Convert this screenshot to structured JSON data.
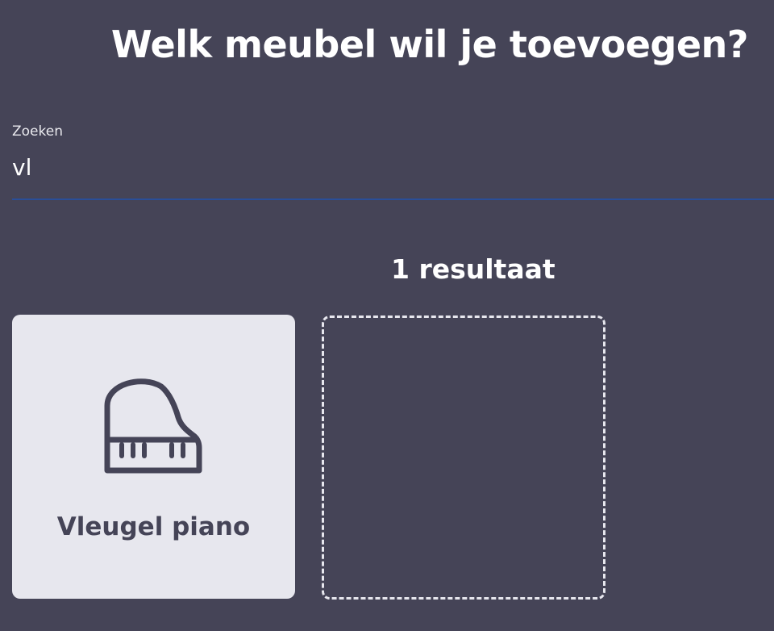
{
  "header": {
    "title": "Welk meubel wil je toevoegen?"
  },
  "search": {
    "label": "Zoeken",
    "value": "vl"
  },
  "results": {
    "count_text": "1 resultaat",
    "items": [
      {
        "label": "Vleugel piano",
        "icon": "grand-piano-icon"
      }
    ]
  },
  "colors": {
    "background": "#454457",
    "card": "#e7e7ee",
    "accent": "#2a4e98"
  }
}
